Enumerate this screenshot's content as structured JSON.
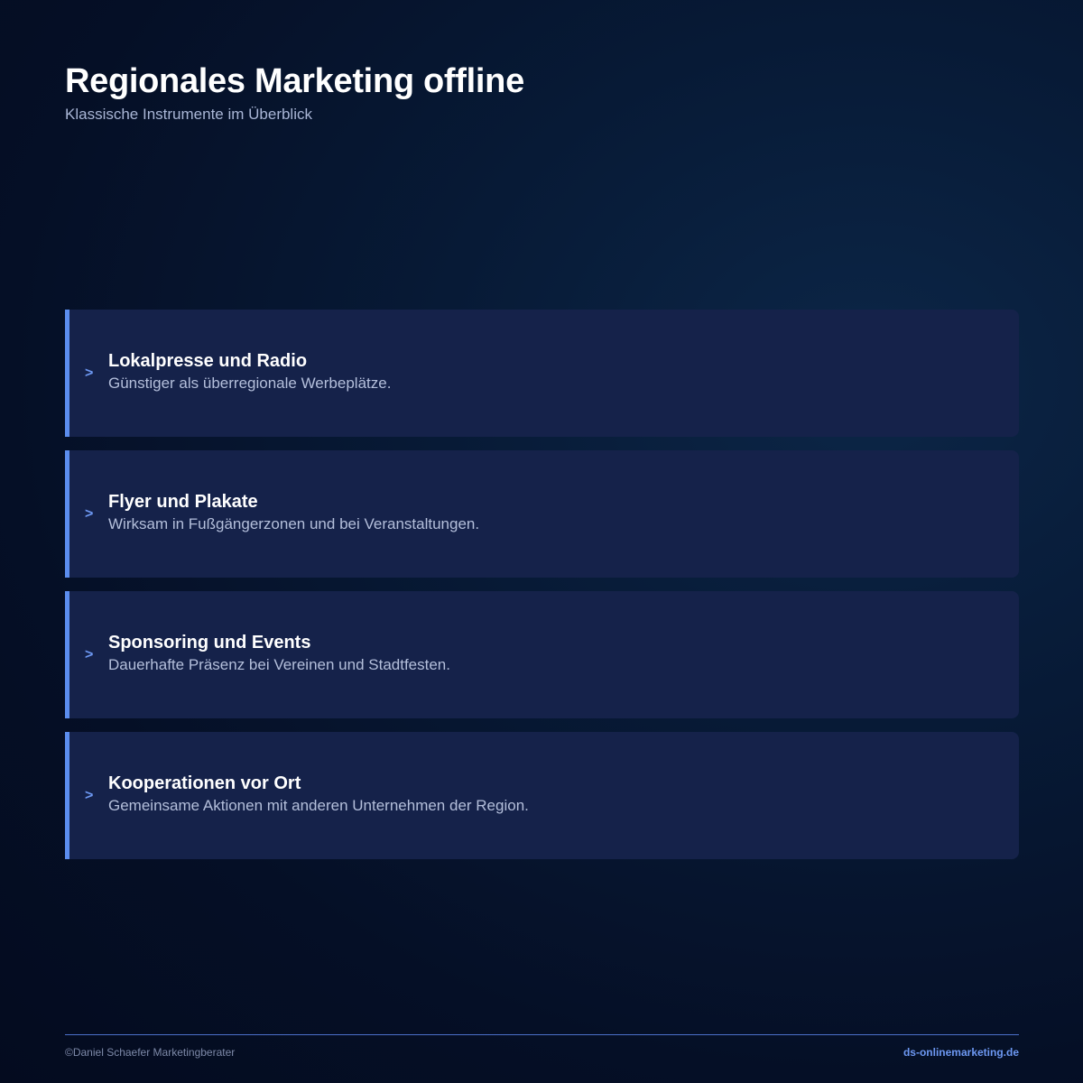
{
  "header": {
    "title": "Regionales Marketing offline",
    "subtitle": "Klassische Instrumente im Überblick"
  },
  "items": [
    {
      "icon": "chevron-right-icon",
      "glyph": ">",
      "title": "Lokalpresse und Radio",
      "description": "Günstiger als überregionale Werbeplätze."
    },
    {
      "icon": "chevron-right-icon",
      "glyph": ">",
      "title": "Flyer und Plakate",
      "description": "Wirksam in Fußgängerzonen und bei Veranstaltungen."
    },
    {
      "icon": "chevron-right-icon",
      "glyph": ">",
      "title": "Sponsoring und Events",
      "description": "Dauerhafte Präsenz bei Vereinen und Stadtfesten."
    },
    {
      "icon": "chevron-right-icon",
      "glyph": ">",
      "title": "Kooperationen vor Ort",
      "description": "Gemeinsame Aktionen mit anderen Unternehmen der Region."
    }
  ],
  "footer": {
    "copyright": "©Daniel Schaefer Marketingberater",
    "website": "ds-onlinemarketing.de"
  },
  "colors": {
    "accent": "#5b8def",
    "card_background": "#15224a",
    "page_background": "#071a36"
  }
}
